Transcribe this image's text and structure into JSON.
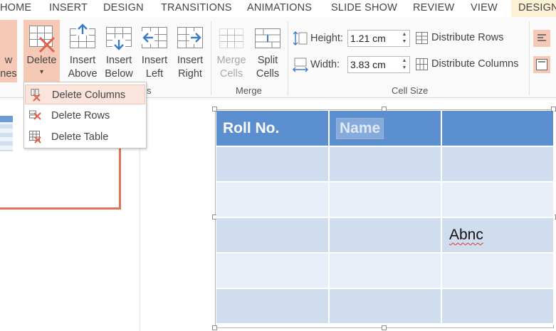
{
  "tabs": [
    "HOME",
    "INSERT",
    "DESIGN",
    "TRANSITIONS",
    "ANIMATIONS",
    "SLIDE SHOW",
    "REVIEW",
    "VIEW",
    "DESIGN"
  ],
  "ribbon": {
    "partial_left": {
      "line1": "w",
      "line2": "nes"
    },
    "delete": {
      "label": "Delete",
      "arrow": "▾"
    },
    "insert_above": {
      "line1": "Insert",
      "line2": "Above"
    },
    "insert_below": {
      "line1": "Insert",
      "line2": "Below"
    },
    "insert_left": {
      "line1": "Insert",
      "line2": "Left"
    },
    "insert_right": {
      "line1": "Insert",
      "line2": "Right"
    },
    "rows_cols_group_partial": "s",
    "merge_cells": {
      "line1": "Merge",
      "line2": "Cells"
    },
    "split_cells": {
      "line1": "Split",
      "line2": "Cells"
    },
    "merge_group": "Merge",
    "height_label": "Height:",
    "height_value": "1.21 cm",
    "width_label": "Width:",
    "width_value": "3.83 cm",
    "distribute_rows": "Distribute Rows",
    "distribute_columns": "Distribute Columns",
    "cell_size_group": "Cell Size"
  },
  "delete_menu": {
    "items": [
      {
        "label": "Delete Columns",
        "icon": "delete-columns-icon"
      },
      {
        "label": "Delete Rows",
        "icon": "delete-rows-icon"
      },
      {
        "label": "Delete Table",
        "icon": "delete-table-icon"
      }
    ]
  },
  "table": {
    "header": [
      "Roll No.",
      "Name",
      ""
    ],
    "rows": [
      [
        "",
        "",
        ""
      ],
      [
        "",
        "",
        ""
      ],
      [
        "",
        "",
        "Abnc"
      ],
      [
        "",
        "",
        ""
      ],
      [
        "",
        "",
        ""
      ]
    ]
  },
  "colors": {
    "accent": "#e2725b",
    "highlight": "#f6c9b6",
    "table_header": "#5b8fd0",
    "table_band_dark": "#cfddee",
    "table_band_light": "#e9eff8"
  }
}
